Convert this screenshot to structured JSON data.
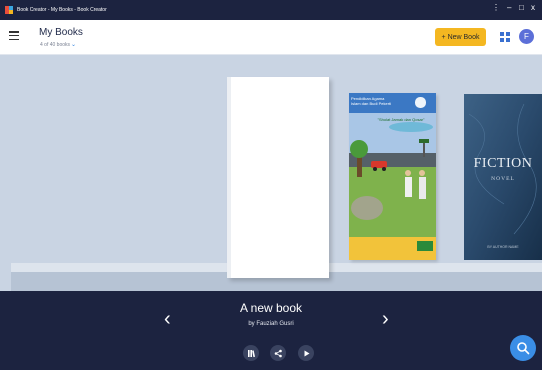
{
  "window": {
    "title": "Book Creator - My Books - Book Creator",
    "controls": {
      "menu": "⋮",
      "minimize": "–",
      "maximize": "□",
      "close": "x"
    }
  },
  "header": {
    "title": "My Books",
    "subtitle": "4 of 40 books",
    "new_book_label": "+ New Book",
    "avatar_initial": "F"
  },
  "shelf": {
    "books": [
      {
        "kind": "new"
      },
      {
        "kind": "cover",
        "title_lines": [
          "Pendidikan Agama",
          "Islam dan Budi Pekerti"
        ],
        "subtitle": "\"Sholat Jamak dan Qosar\""
      },
      {
        "kind": "cover",
        "title": "FICTION",
        "subtitle": "NOVEL",
        "author": "BY AUTHOR NAME"
      }
    ]
  },
  "selected_book": {
    "title": "A new book",
    "author": "by Fauziah Gusri"
  },
  "nav": {
    "prev": "‹",
    "next": "›"
  },
  "colors": {
    "accent": "#f4b721",
    "brand": "#1c2340",
    "search": "#3a8ee6"
  }
}
